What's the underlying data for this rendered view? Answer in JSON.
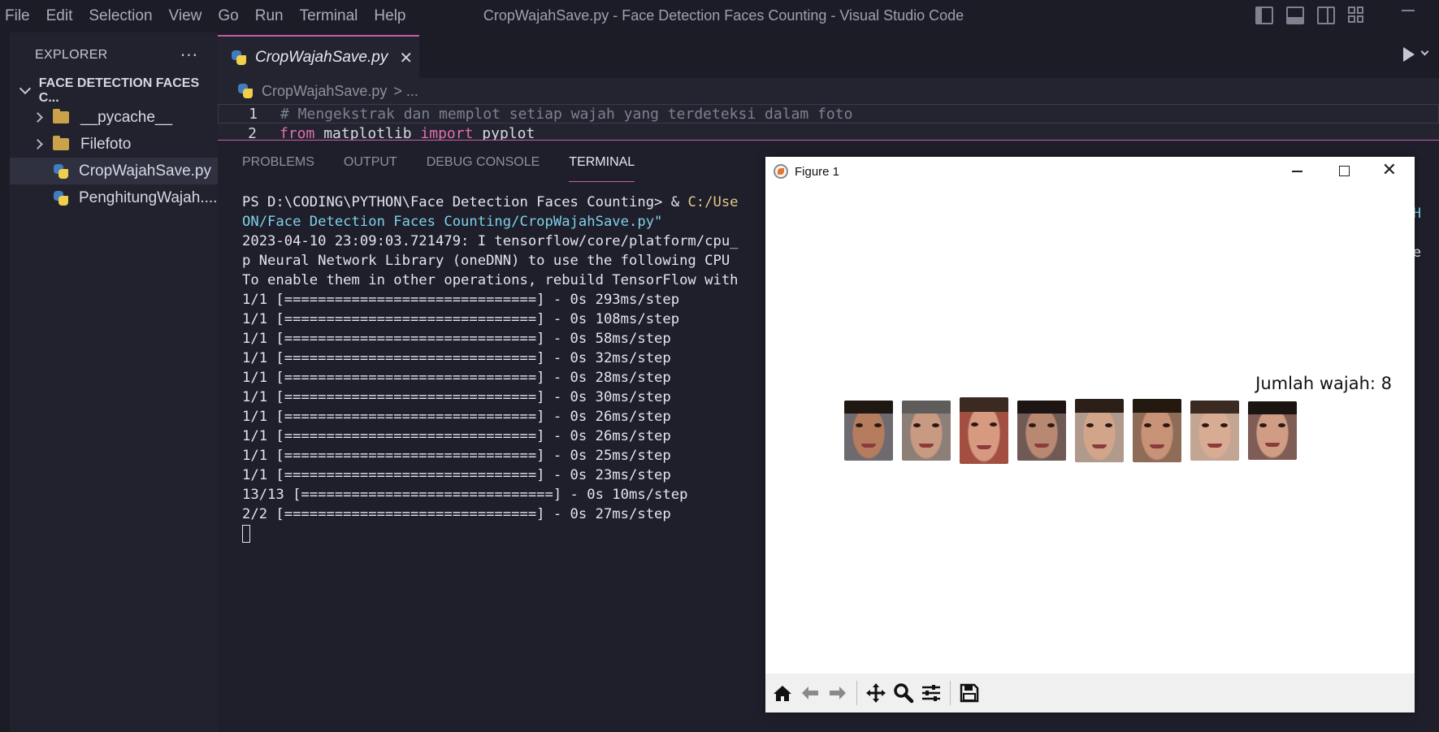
{
  "app": {
    "menu": [
      "File",
      "Edit",
      "Selection",
      "View",
      "Go",
      "Run",
      "Terminal",
      "Help"
    ],
    "window_title": "CropWajahSave.py - Face Detection Faces Counting - Visual Studio Code"
  },
  "sidebar": {
    "header": "EXPLORER",
    "more": "···",
    "folder": "FACE DETECTION FACES C...",
    "items": [
      {
        "label": "__pycache__",
        "type": "folder"
      },
      {
        "label": "Filefoto",
        "type": "folder"
      },
      {
        "label": "CropWajahSave.py",
        "type": "python",
        "active": true
      },
      {
        "label": "PenghitungWajah....",
        "type": "python"
      }
    ]
  },
  "editor": {
    "tab_label": "CropWajahSave.py",
    "tab_close": "✕",
    "breadcrumb_file": "CropWajahSave.py",
    "breadcrumb_rest": "> ...",
    "line1_num": "1",
    "line1_text": "# Mengekstrak dan memplot setiap wajah yang terdeteksi dalam foto",
    "line2_num": "2",
    "line2_kw1": "from",
    "line2_mod": " matplotlib ",
    "line2_kw2": "import",
    "line2_name": " pyplot"
  },
  "panel": {
    "tabs": [
      "PROBLEMS",
      "OUTPUT",
      "DEBUG CONSOLE",
      "TERMINAL"
    ],
    "active_tab": "TERMINAL",
    "terminal": {
      "prompt": "PS D:\\CODING\\PYTHON\\Face Detection Faces Counting> & ",
      "prompt_link": "C:/Use",
      "path_cont": "ON/Face Detection Faces Counting/CropWajahSave.py\"",
      "lines": [
        "2023-04-10 23:09:03.721479: I tensorflow/core/platform/cpu_",
        "p Neural Network Library (oneDNN) to use the following CPU ",
        "To enable them in other operations, rebuild TensorFlow with",
        "1/1 [==============================] - 0s 293ms/step",
        "1/1 [==============================] - 0s 108ms/step",
        "1/1 [==============================] - 0s 58ms/step",
        "1/1 [==============================] - 0s 32ms/step",
        "1/1 [==============================] - 0s 28ms/step",
        "1/1 [==============================] - 0s 30ms/step",
        "1/1 [==============================] - 0s 26ms/step",
        "1/1 [==============================] - 0s 26ms/step",
        "1/1 [==============================] - 0s 25ms/step",
        "1/1 [==============================] - 0s 23ms/step",
        "13/13 [==============================] - 0s 10ms/step",
        "2/2 [==============================] - 0s 27ms/step"
      ],
      "right_edge_1": "H",
      "right_edge_2": "e"
    }
  },
  "figure": {
    "title": "Figure 1",
    "count_label": "Jumlah wajah: 8",
    "face_count": 8,
    "faces": [
      {
        "skin": "#b57d5e",
        "hair": "#1e1712",
        "bg": "#6e6a70"
      },
      {
        "skin": "#c99a82",
        "hair": "#5f5c5c",
        "bg": "#8c7f78"
      },
      {
        "skin": "#d79a80",
        "hair": "#3a2a22",
        "bg": "#a24f42"
      },
      {
        "skin": "#b98873",
        "hair": "#1c1513",
        "bg": "#6f5a55"
      },
      {
        "skin": "#d2a58b",
        "hair": "#2b1f18",
        "bg": "#b09a8c"
      },
      {
        "skin": "#c79276",
        "hair": "#24190f",
        "bg": "#8f6c58"
      },
      {
        "skin": "#d8ab93",
        "hair": "#3a2a22",
        "bg": "#c3a594"
      },
      {
        "skin": "#d09c84",
        "hair": "#1b1410",
        "bg": "#7d5d55"
      }
    ],
    "toolbar": [
      "home-icon",
      "back-icon",
      "forward-icon",
      "pan-icon",
      "zoom-icon",
      "configure-icon",
      "save-icon"
    ]
  }
}
